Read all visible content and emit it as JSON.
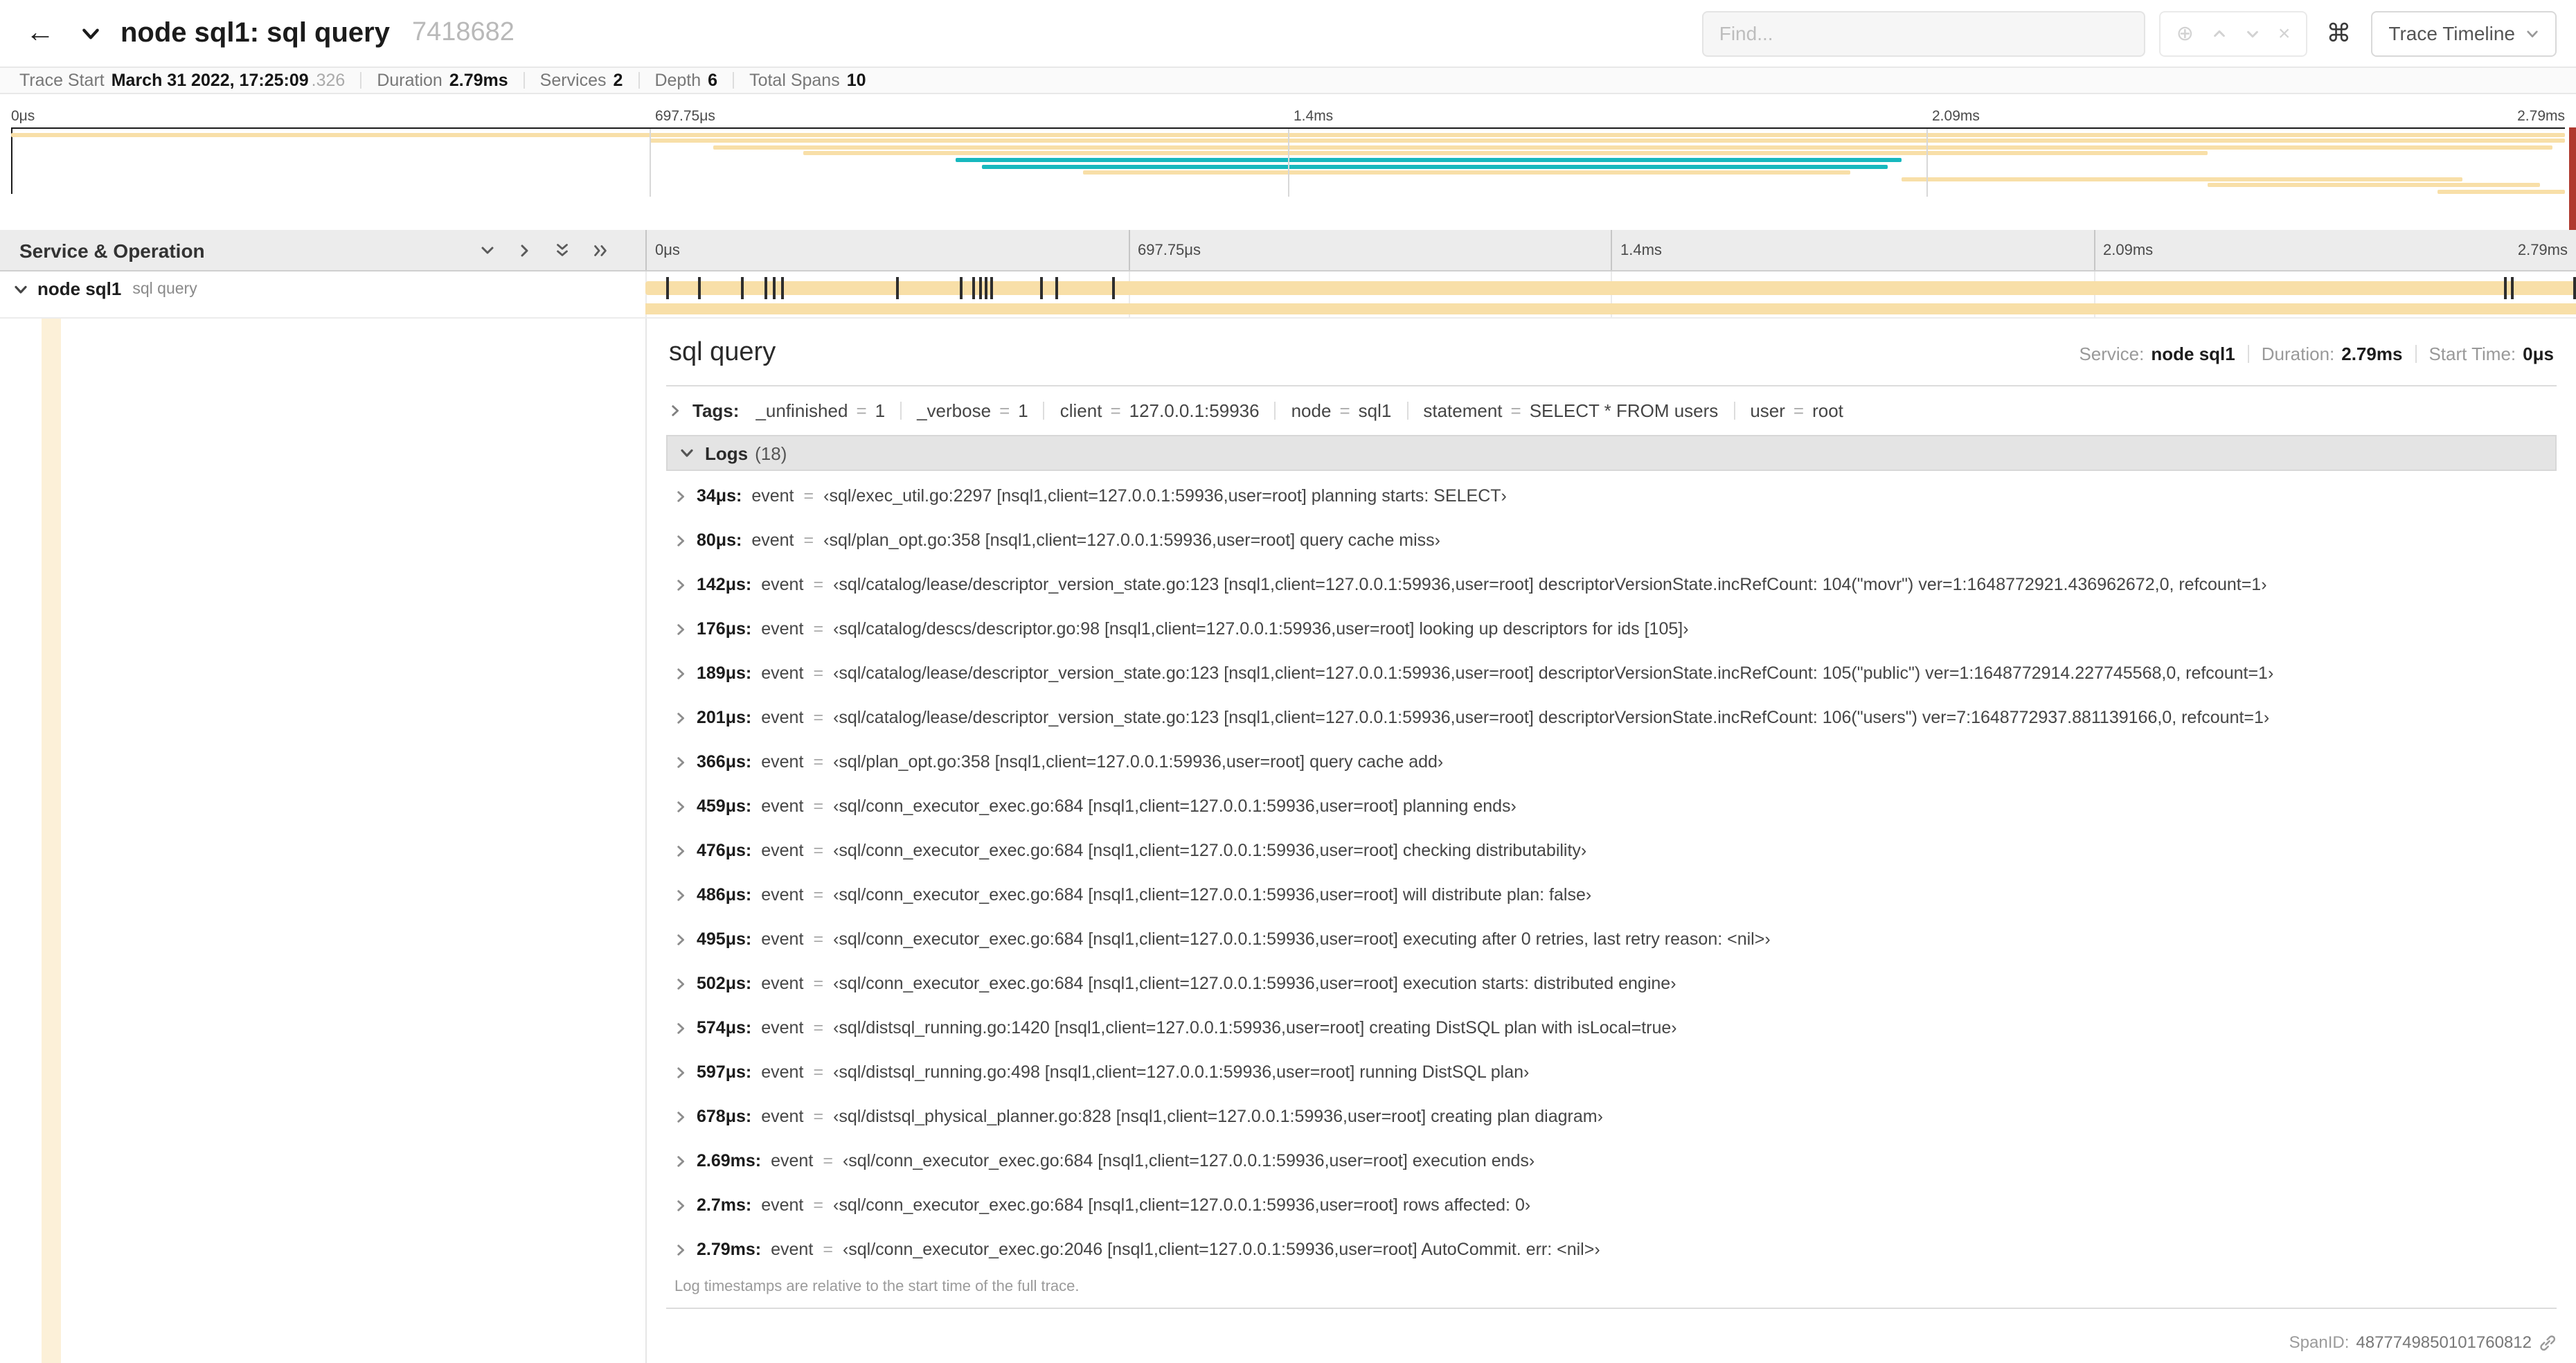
{
  "header": {
    "back_icon": "←",
    "title": "node sql1: sql query",
    "trace_id": "7418682",
    "find_placeholder": "Find...",
    "locate_icon": "⊕",
    "clear_icon": "×",
    "command_icon": "⌘",
    "view_button": "Trace Timeline"
  },
  "summary": {
    "items": [
      {
        "label": "Trace Start",
        "value": "March 31 2022, 17:25:09",
        "suffix": ".326"
      },
      {
        "label": "Duration",
        "value": "2.79ms"
      },
      {
        "label": "Services",
        "value": "2"
      },
      {
        "label": "Depth",
        "value": "6"
      },
      {
        "label": "Total Spans",
        "value": "10"
      }
    ]
  },
  "minimap": {
    "ticks": [
      "0μs",
      "697.75μs",
      "1.4ms",
      "2.09ms",
      "2.79ms"
    ],
    "spans": [
      {
        "row": 0,
        "start": 0,
        "end": 100,
        "color": "#F8DFA8"
      },
      {
        "row": 1,
        "start": 25,
        "end": 100,
        "color": "#F8DFA8"
      },
      {
        "row": 2,
        "start": 27.5,
        "end": 99.5,
        "color": "#F8DFA8"
      },
      {
        "row": 3,
        "start": 31,
        "end": 86,
        "color": "#F8DFA8"
      },
      {
        "row": 4,
        "start": 37,
        "end": 74,
        "color": "#17B8BE"
      },
      {
        "row": 5,
        "start": 38,
        "end": 73.5,
        "color": "#17B8BE"
      },
      {
        "row": 6,
        "start": 42,
        "end": 72,
        "color": "#F8DFA8"
      },
      {
        "row": 7,
        "start": 74,
        "end": 96,
        "color": "#F8DFA8"
      },
      {
        "row": 8,
        "start": 86,
        "end": 99,
        "color": "#F8DFA8"
      },
      {
        "row": 9,
        "start": 95,
        "end": 100,
        "color": "#F8DFA8"
      }
    ]
  },
  "timeline": {
    "header_left": "Service & Operation",
    "ticks": [
      "0μs",
      "697.75μs",
      "1.4ms",
      "2.09ms",
      "2.79ms"
    ],
    "row": {
      "service": "node sql1",
      "operation": "sql query"
    },
    "log_marker_pcts": [
      1.22,
      2.87,
      5.09,
      6.31,
      6.77,
      7.2,
      13.12,
      16.45,
      17.06,
      17.42,
      17.74,
      18.0,
      20.57,
      21.4,
      24.3,
      96.42,
      96.77,
      100
    ]
  },
  "detail": {
    "operation": "sql query",
    "service_label": "Service:",
    "service": "node sql1",
    "duration_label": "Duration:",
    "duration": "2.79ms",
    "start_label": "Start Time:",
    "start": "0μs",
    "tags_label": "Tags:",
    "tags": [
      {
        "key": "_unfinished",
        "value": "1"
      },
      {
        "key": "_verbose",
        "value": "1"
      },
      {
        "key": "client",
        "value": "127.0.0.1:59936"
      },
      {
        "key": "node",
        "value": "sql1"
      },
      {
        "key": "statement",
        "value": "SELECT * FROM users"
      },
      {
        "key": "user",
        "value": "root"
      }
    ],
    "logs_label": "Logs",
    "logs_count": "(18)",
    "logs": [
      {
        "time": "34μs:",
        "field": "event",
        "value": "‹sql/exec_util.go:2297 [nsql1,client=127.0.0.1:59936,user=root] planning starts: SELECT›"
      },
      {
        "time": "80μs:",
        "field": "event",
        "value": "‹sql/plan_opt.go:358 [nsql1,client=127.0.0.1:59936,user=root] query cache miss›"
      },
      {
        "time": "142μs:",
        "field": "event",
        "value": "‹sql/catalog/lease/descriptor_version_state.go:123 [nsql1,client=127.0.0.1:59936,user=root] descriptorVersionState.incRefCount: 104(\"movr\") ver=1:1648772921.436962672,0, refcount=1›"
      },
      {
        "time": "176μs:",
        "field": "event",
        "value": "‹sql/catalog/descs/descriptor.go:98 [nsql1,client=127.0.0.1:59936,user=root] looking up descriptors for ids [105]›"
      },
      {
        "time": "189μs:",
        "field": "event",
        "value": "‹sql/catalog/lease/descriptor_version_state.go:123 [nsql1,client=127.0.0.1:59936,user=root] descriptorVersionState.incRefCount: 105(\"public\") ver=1:1648772914.227745568,0, refcount=1›"
      },
      {
        "time": "201μs:",
        "field": "event",
        "value": "‹sql/catalog/lease/descriptor_version_state.go:123 [nsql1,client=127.0.0.1:59936,user=root] descriptorVersionState.incRefCount: 106(\"users\") ver=7:1648772937.881139166,0, refcount=1›"
      },
      {
        "time": "366μs:",
        "field": "event",
        "value": "‹sql/plan_opt.go:358 [nsql1,client=127.0.0.1:59936,user=root] query cache add›"
      },
      {
        "time": "459μs:",
        "field": "event",
        "value": "‹sql/conn_executor_exec.go:684 [nsql1,client=127.0.0.1:59936,user=root] planning ends›"
      },
      {
        "time": "476μs:",
        "field": "event",
        "value": "‹sql/conn_executor_exec.go:684 [nsql1,client=127.0.0.1:59936,user=root] checking distributability›"
      },
      {
        "time": "486μs:",
        "field": "event",
        "value": "‹sql/conn_executor_exec.go:684 [nsql1,client=127.0.0.1:59936,user=root] will distribute plan: false›"
      },
      {
        "time": "495μs:",
        "field": "event",
        "value": "‹sql/conn_executor_exec.go:684 [nsql1,client=127.0.0.1:59936,user=root] executing after 0 retries, last retry reason: <nil>›"
      },
      {
        "time": "502μs:",
        "field": "event",
        "value": "‹sql/conn_executor_exec.go:684 [nsql1,client=127.0.0.1:59936,user=root] execution starts: distributed engine›"
      },
      {
        "time": "574μs:",
        "field": "event",
        "value": "‹sql/distsql_running.go:1420 [nsql1,client=127.0.0.1:59936,user=root] creating DistSQL plan with isLocal=true›"
      },
      {
        "time": "597μs:",
        "field": "event",
        "value": "‹sql/distsql_running.go:498 [nsql1,client=127.0.0.1:59936,user=root] running DistSQL plan›"
      },
      {
        "time": "678μs:",
        "field": "event",
        "value": "‹sql/distsql_physical_planner.go:828 [nsql1,client=127.0.0.1:59936,user=root] creating plan diagram›"
      },
      {
        "time": "2.69ms:",
        "field": "event",
        "value": "‹sql/conn_executor_exec.go:684 [nsql1,client=127.0.0.1:59936,user=root] execution ends›"
      },
      {
        "time": "2.7ms:",
        "field": "event",
        "value": "‹sql/conn_executor_exec.go:684 [nsql1,client=127.0.0.1:59936,user=root] rows affected: 0›"
      },
      {
        "time": "2.79ms:",
        "field": "event",
        "value": "‹sql/conn_executor_exec.go:2046 [nsql1,client=127.0.0.1:59936,user=root] AutoCommit. err: <nil>›"
      }
    ],
    "logs_note": "Log timestamps are relative to the start time of the full trace.",
    "span_id_label": "SpanID:",
    "span_id": "4877749850101760812"
  },
  "misc": {
    "eq": "="
  },
  "colors": {
    "span_tan": "#F8DFA8",
    "span_teal": "#17B8BE",
    "indent_guide": "#FCF0D8",
    "end_marker_red": "#b0392e"
  }
}
